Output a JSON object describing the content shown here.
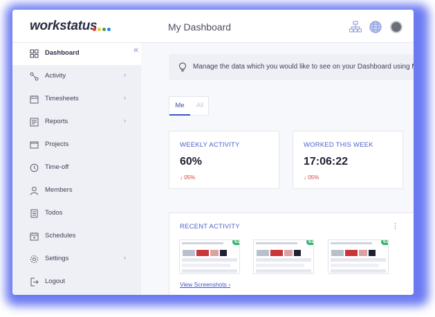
{
  "brand": {
    "name": "workstatus",
    "dot_colors": [
      "#e53935",
      "#fbc02d",
      "#43a047",
      "#1e88e5"
    ]
  },
  "header": {
    "title": "My Dashboard"
  },
  "sidebar": {
    "items": [
      {
        "label": "Dashboard",
        "icon": "dashboard-icon",
        "active": true,
        "has_chevron": false
      },
      {
        "label": "Activity",
        "icon": "activity-icon",
        "active": false,
        "has_chevron": true
      },
      {
        "label": "Timesheets",
        "icon": "calendar-icon",
        "active": false,
        "has_chevron": true
      },
      {
        "label": "Reports",
        "icon": "reports-icon",
        "active": false,
        "has_chevron": true
      },
      {
        "label": "Projects",
        "icon": "folder-icon",
        "active": false,
        "has_chevron": false
      },
      {
        "label": "Time-off",
        "icon": "clock-icon",
        "active": false,
        "has_chevron": false
      },
      {
        "label": "Members",
        "icon": "user-icon",
        "active": false,
        "has_chevron": false
      },
      {
        "label": "Todos",
        "icon": "list-icon",
        "active": false,
        "has_chevron": false
      },
      {
        "label": "Schedules",
        "icon": "schedule-icon",
        "active": false,
        "has_chevron": false
      },
      {
        "label": "Settings",
        "icon": "gear-icon",
        "active": false,
        "has_chevron": true
      },
      {
        "label": "Logout",
        "icon": "logout-icon",
        "active": false,
        "has_chevron": false
      }
    ]
  },
  "banner": {
    "text": "Manage the data which you would like to see on your Dashboard using Ma"
  },
  "filter": {
    "me_label": "Me",
    "all_label": "All"
  },
  "cards": {
    "weekly_activity": {
      "title": "WEEKLY ACTIVITY",
      "value": "60%",
      "delta": "↓ 05%"
    },
    "worked_this_week": {
      "title": "WORKED THIS WEEK",
      "value": "17:06:22",
      "delta": "↓ 05%"
    }
  },
  "recent_activity": {
    "title": "RECENT ACTIVITY",
    "screenshots": [
      {
        "percent": "61%"
      },
      {
        "percent": "61%"
      },
      {
        "percent": "61%"
      }
    ],
    "view_link": "View Screenshots ›"
  },
  "colors": {
    "accent": "#3d52c9",
    "glow": "#5b6cf0",
    "negative": "#d6413f",
    "badge": "#2fb36b"
  }
}
